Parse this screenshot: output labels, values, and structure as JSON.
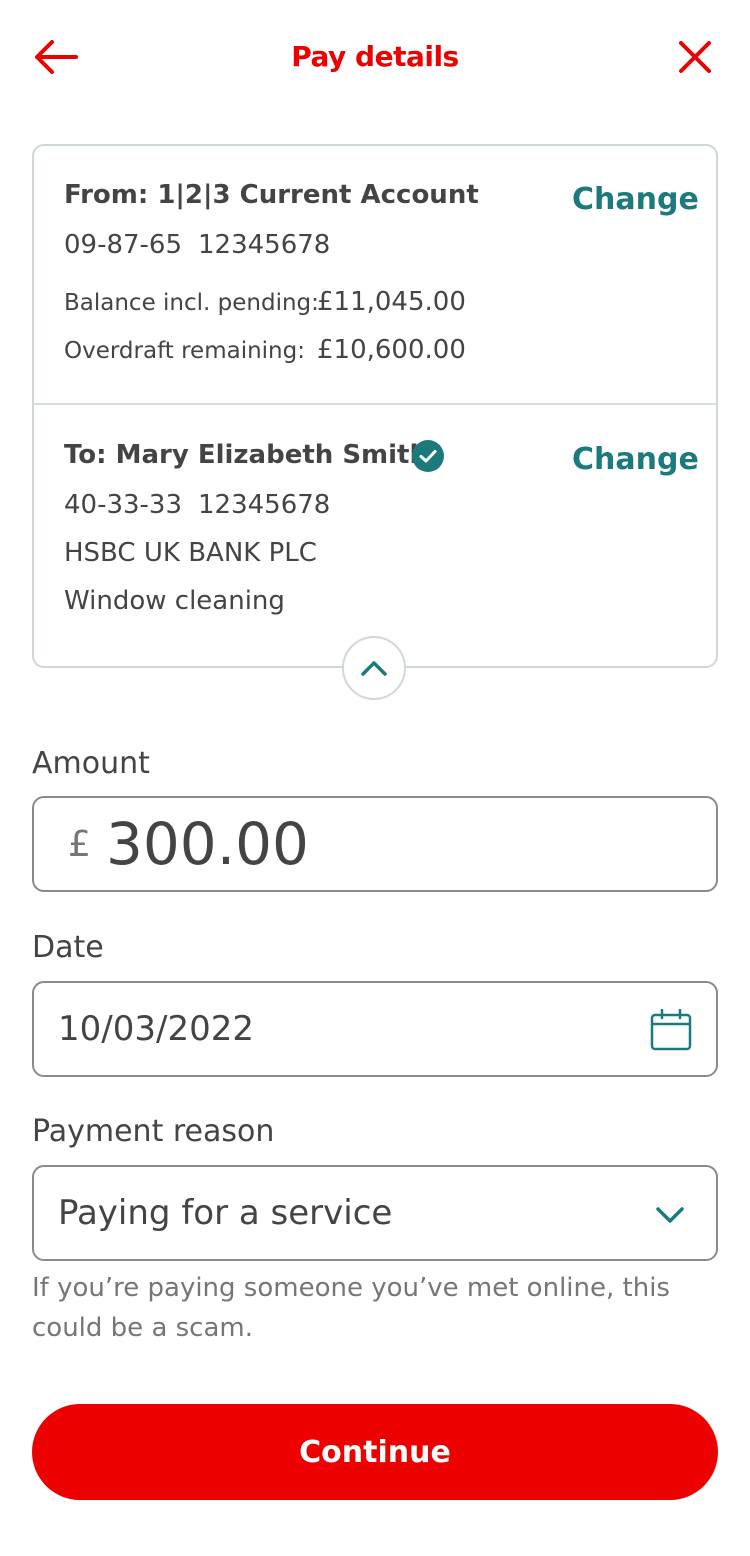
{
  "header": {
    "title": "Pay details",
    "back_icon": "arrow-left-icon",
    "close_icon": "close-icon",
    "accent_color": "#ec0000"
  },
  "from": {
    "title": "From: 1|2|3 Current Account",
    "sort_code": "09-87-65",
    "account_number": "12345678",
    "balance_label": "Balance incl. pending:",
    "balance_value": "£11,045.00",
    "overdraft_label": "Overdraft remaining:",
    "overdraft_value": "£10,600.00",
    "change_label": "Change"
  },
  "to": {
    "title": "To: Mary Elizabeth Smith",
    "verified_icon": "check-circle-icon",
    "sort_code": "40-33-33",
    "account_number": "12345678",
    "bank": "HSBC UK BANK PLC",
    "reference": "Window cleaning",
    "change_label": "Change"
  },
  "collapse_icon": "chevron-up-icon",
  "amount": {
    "label": "Amount",
    "currency": "£",
    "value": "300.00"
  },
  "date": {
    "label": "Date",
    "value": "10/03/2022",
    "icon": "calendar-icon"
  },
  "payment_reason": {
    "label": "Payment reason",
    "value": "Paying for a service",
    "icon": "chevron-down-icon",
    "hint": "If you’re paying someone you’ve met online, this could be a scam."
  },
  "continue_label": "Continue",
  "teal_color": "#1c7a7c"
}
